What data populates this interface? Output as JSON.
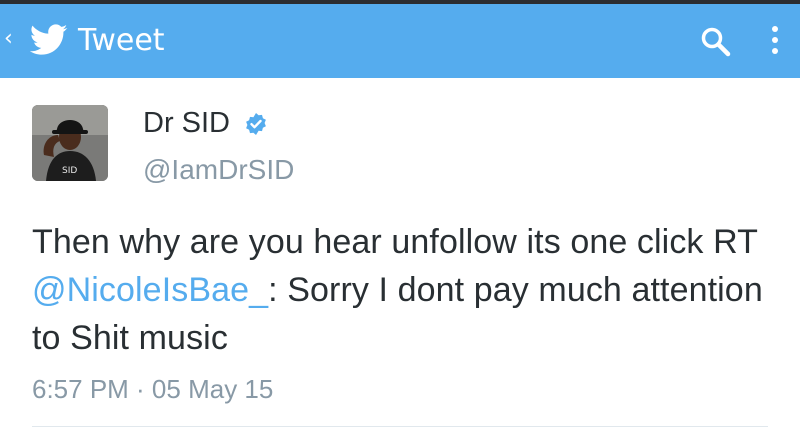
{
  "app_bar": {
    "title": "Tweet",
    "icons": [
      "back-arrow-icon",
      "twitter-bird-icon",
      "search-icon",
      "more-vertical-icon"
    ],
    "color": "#55acee"
  },
  "tweet": {
    "author_name": "Dr SID",
    "verified": true,
    "handle": "@IamDrSID",
    "text_before": "Then why are you hear unfollow its one click RT ",
    "mention": "@NicoleIsBae_",
    "text_after": ": Sorry I dont pay much attention to Shit music",
    "timestamp": "6:57 PM · 05 May 15"
  },
  "colors": {
    "link": "#55acee",
    "text": "#292f33",
    "muted": "#8899a6",
    "verified": "#55acee"
  }
}
